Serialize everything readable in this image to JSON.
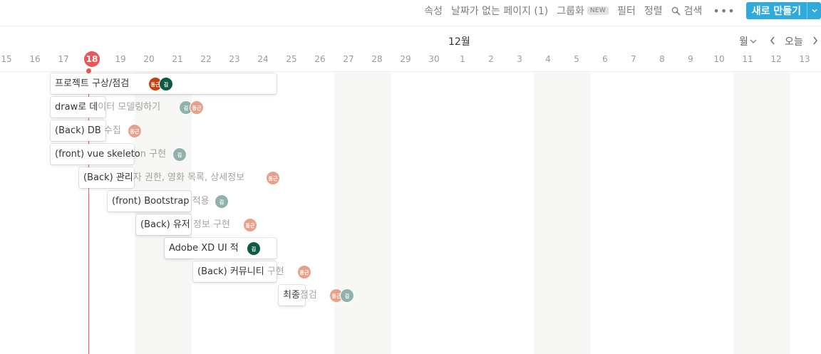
{
  "toolbar": {
    "properties": "속성",
    "no_date_pages": "날짜가 없는 페이지 (1)",
    "group": "그룹화",
    "group_badge": "NEW",
    "filter": "필터",
    "sort": "정렬",
    "search": "검색",
    "more": "•••",
    "new_button": "새로 만들기"
  },
  "calendar": {
    "month": "12월",
    "view": "월",
    "today": "오늘",
    "dates": [
      "15",
      "16",
      "17",
      "18",
      "19",
      "20",
      "21",
      "22",
      "23",
      "24",
      "25",
      "26",
      "27",
      "28",
      "29",
      "30",
      "1",
      "2",
      "3",
      "4",
      "5",
      "6",
      "7",
      "8",
      "9",
      "10",
      "11",
      "12",
      "13"
    ],
    "today_date": "18"
  },
  "colors": {
    "accent": "#2eaadc",
    "today": "#eb5757",
    "avatar_donggeun": "#e8a08a",
    "avatar_kim_gray": "#8fb3aa",
    "avatar_kim_dark": "#0b5a45",
    "avatar_orange": "#c2410c"
  },
  "events": [
    {
      "in": "프로젝트 구상/점검",
      "out": "",
      "avatars": [
        {
          "text": "동근",
          "color": "#c2410c"
        },
        {
          "text": "김",
          "color": "#0b5a45"
        }
      ]
    },
    {
      "in": "draw로 데",
      "out": "이터 모델링하기",
      "avatars": [
        {
          "text": "김",
          "color": "#8fb3aa"
        },
        {
          "text": "동근",
          "color": "#e8a08a"
        }
      ]
    },
    {
      "in": "(Back) DB ",
      "out": "수집",
      "avatars": [
        {
          "text": "동근",
          "color": "#e8a08a"
        }
      ]
    },
    {
      "in": "(front) vue skeleto",
      "out": "n 구현",
      "avatars": [
        {
          "text": "김",
          "color": "#8fb3aa"
        }
      ]
    },
    {
      "in": "(Back) 관리",
      "out": "자 권한, 영화 목록, 상세정보",
      "avatars": [
        {
          "text": "동근",
          "color": "#e8a08a"
        }
      ]
    },
    {
      "in": "(front) Bootstrap ",
      "out": "적용",
      "avatars": [
        {
          "text": "김",
          "color": "#8fb3aa"
        }
      ]
    },
    {
      "in": "(Back) 유저",
      "out": " 정보 구현",
      "avatars": [
        {
          "text": "동근",
          "color": "#e8a08a"
        }
      ]
    },
    {
      "in": "Adobe XD UI 적",
      "out": "",
      "avatars": [
        {
          "text": "김",
          "color": "#0b5a45"
        }
      ]
    },
    {
      "in": "(Back) 커뮤니티 ",
      "out": "구현",
      "avatars": [
        {
          "text": "동근",
          "color": "#e8a08a"
        }
      ]
    },
    {
      "in": "최종",
      "out": "점검",
      "avatars": [
        {
          "text": "동근",
          "color": "#e8a08a"
        },
        {
          "text": "김",
          "color": "#8fb3aa"
        }
      ]
    }
  ]
}
